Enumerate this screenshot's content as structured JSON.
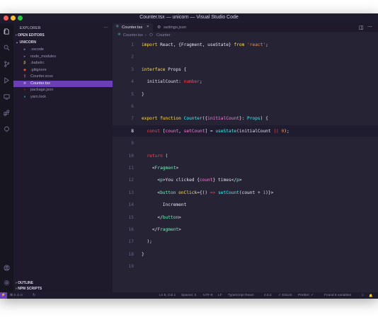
{
  "window": {
    "title": "Counter.tsx — unicorn — Visual Studio Code",
    "traffic_lights": [
      "#ff5f57",
      "#febc2e",
      "#28c840"
    ]
  },
  "activity_bar": {
    "icons": [
      "files-icon",
      "search-icon",
      "source-control-icon",
      "run-debug-icon",
      "remote-explorer-icon",
      "extensions-icon",
      "live-share-icon",
      "account-icon",
      "settings-gear-icon"
    ]
  },
  "sidebar": {
    "header": "EXPLORER",
    "more": "···",
    "open_editors": "OPEN EDITORS",
    "root": "UNICORN",
    "files": [
      {
        "name": ".vscode",
        "icon": "folder-icon",
        "color": "#6c8ebf"
      },
      {
        "name": "node_modules",
        "icon": "folder-icon",
        "color": "#7a7596"
      },
      {
        "name": ".babelrc",
        "icon": "babel-icon",
        "color": "#f5da55"
      },
      {
        "name": ".gitignore",
        "icon": "git-icon",
        "color": "#f05133"
      },
      {
        "name": "Counter.scss",
        "icon": "scss-icon",
        "color": "#cd6799"
      },
      {
        "name": "Counter.tsx",
        "icon": "react-icon",
        "color": "#ffffff",
        "selected": true
      },
      {
        "name": "package.json",
        "icon": "npm-icon",
        "color": "#cb3837"
      },
      {
        "name": "yarn.lock",
        "icon": "yarn-icon",
        "color": "#2c8ebb"
      }
    ],
    "outline": "OUTLINE",
    "npm_scripts": "NPM SCRIPTS"
  },
  "tabs": [
    {
      "label": "Counter.tsx",
      "close": "×",
      "active": true
    },
    {
      "label": "settings.json",
      "active": false
    }
  ],
  "tab_actions": {
    "split": "◫",
    "more": "···"
  },
  "breadcrumb": {
    "file": "Counter.tsx",
    "symbol": "Counter",
    "sep": "›"
  },
  "editor": {
    "current_line": 8,
    "lines": [
      [
        [
          "kw",
          "import "
        ],
        [
          "wh",
          "React, {Fragment, useState} "
        ],
        [
          "kw",
          "from "
        ],
        [
          "str",
          "'react'"
        ],
        [
          "wh",
          ";"
        ]
      ],
      [],
      [
        [
          "kw",
          "interface "
        ],
        [
          "wh",
          "Props {"
        ]
      ],
      [
        [
          "wh",
          "  initialCount: "
        ],
        [
          "ty",
          "number"
        ],
        [
          "wh",
          ";"
        ]
      ],
      [
        [
          "wh",
          "}"
        ]
      ],
      [],
      [
        [
          "kw",
          "export "
        ],
        [
          "kw",
          "function "
        ],
        [
          "fn",
          "Counter"
        ],
        [
          "wh",
          "({"
        ],
        [
          "pr",
          "initialCount"
        ],
        [
          "wh",
          "}: "
        ],
        [
          "fn",
          "Props"
        ],
        [
          "wh",
          ") {"
        ]
      ],
      [
        [
          "kw2",
          "  const "
        ],
        [
          "wh",
          "["
        ],
        [
          "pr",
          "count"
        ],
        [
          "wh",
          ", "
        ],
        [
          "pr",
          "setCount"
        ],
        [
          "wh",
          "] = "
        ],
        [
          "fn",
          "useState"
        ],
        [
          "wh",
          "(initialCount "
        ],
        [
          "kw2",
          "||"
        ],
        [
          "wh",
          " "
        ],
        [
          "str",
          "0"
        ],
        [
          "wh",
          ");"
        ]
      ],
      [],
      [
        [
          "kw2",
          "  return "
        ],
        [
          "wh",
          "("
        ]
      ],
      [
        [
          "wh",
          "    <"
        ],
        [
          "tg",
          "Fragment"
        ],
        [
          "wh",
          ">"
        ]
      ],
      [
        [
          "wh",
          "      <"
        ],
        [
          "tg",
          "p"
        ],
        [
          "wh",
          ">You clicked {"
        ],
        [
          "pr",
          "count"
        ],
        [
          "wh",
          "} times</"
        ],
        [
          "tg",
          "p"
        ],
        [
          "wh",
          ">"
        ]
      ],
      [
        [
          "wh",
          "      <"
        ],
        [
          "tg",
          "button "
        ],
        [
          "at",
          "onClick"
        ],
        [
          "wh",
          "={() "
        ],
        [
          "kw2",
          "=>"
        ],
        [
          "wh",
          " "
        ],
        [
          "fn",
          "setCount"
        ],
        [
          "wh",
          "(count + "
        ],
        [
          "str",
          "1"
        ],
        [
          "wh",
          ")}>"
        ]
      ],
      [
        [
          "wh",
          "        Increment"
        ]
      ],
      [
        [
          "wh",
          "      </"
        ],
        [
          "tg",
          "button"
        ],
        [
          "wh",
          ">"
        ]
      ],
      [
        [
          "wh",
          "    </"
        ],
        [
          "tg",
          "Fragment"
        ],
        [
          "wh",
          ">"
        ]
      ],
      [
        [
          "wh",
          "  );"
        ]
      ],
      [
        [
          "wh",
          "}"
        ]
      ],
      []
    ]
  },
  "statusbar": {
    "remote": "⚡",
    "problems": "⊗ 2 ⚠ 0",
    "sync": "↻",
    "items": [
      "Ln 8, Col 1",
      "Spaces: 2",
      "UTF-8",
      "LF",
      "TypeScript React",
      "4.0.2",
      "✓ ESLint",
      "Prettier: ✓",
      "Found 6 variables"
    ],
    "feedback": "☺",
    "bell": "🔔"
  }
}
